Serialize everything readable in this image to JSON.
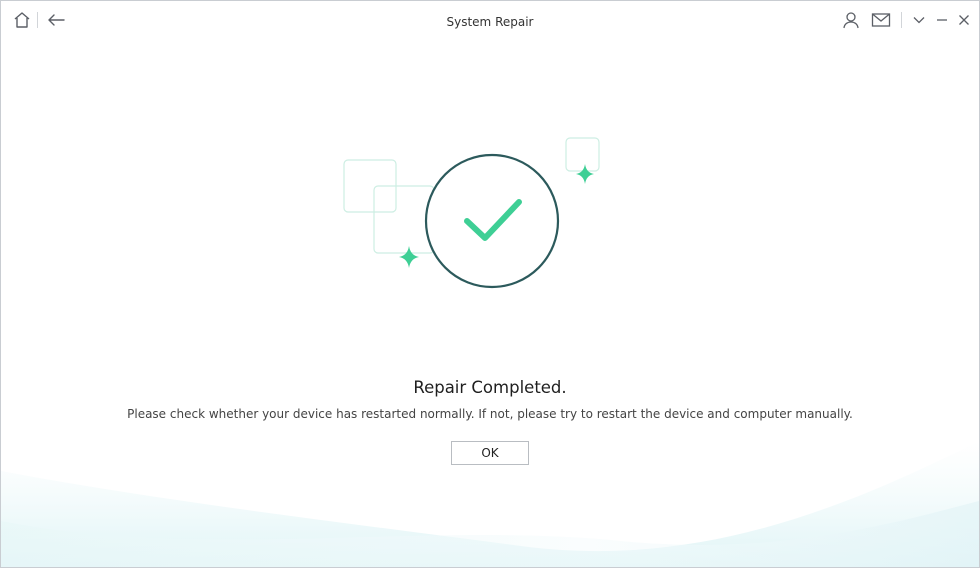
{
  "window": {
    "title": "System Repair"
  },
  "titlebar": {
    "left_icons": [
      "home-icon",
      "back-arrow-icon"
    ],
    "right_icons": [
      "user-icon",
      "mail-icon",
      "chevron-down-icon",
      "minimize-icon",
      "close-icon"
    ]
  },
  "main": {
    "heading": "Repair Completed.",
    "description": "Please check whether your device has restarted normally. If not, please try to restart the device and computer manually.",
    "ok_label": "OK"
  },
  "colors": {
    "circle_stroke": "#2c5a5c",
    "checkmark": "#3ecf95",
    "sparkle": "#3ecf95",
    "square_outline": "#cdeee3",
    "wave_tint": "#e3f6f7"
  }
}
